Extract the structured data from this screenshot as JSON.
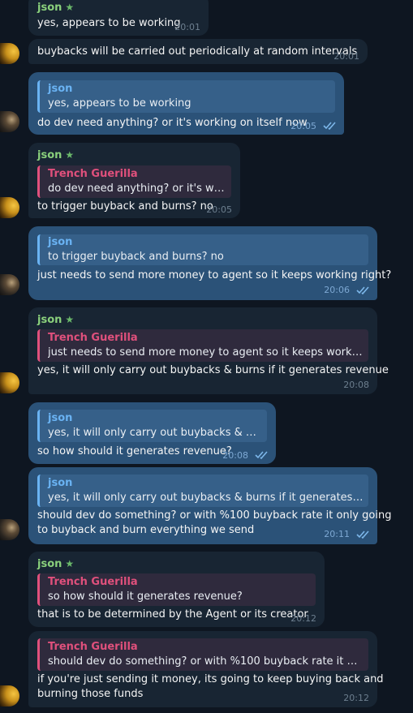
{
  "contacts": {
    "json_name": "json",
    "trench_name": "Trench Guerilla"
  },
  "messages": [
    {
      "text": "yes, appears to be working",
      "time": "20:01"
    },
    {
      "text": "buybacks will be carried out periodically at random intervals",
      "time": "20:01"
    },
    {
      "quote": "yes, appears to be working",
      "text": "do dev need anything? or it's working on itself now",
      "time": "20:05"
    },
    {
      "quote": "do dev need anything? or it's worki...",
      "text": "to trigger buyback and burns? no",
      "time": "20:05"
    },
    {
      "quote": "to trigger buyback and burns? no",
      "text": "just needs to send more money to agent so it keeps working right?",
      "time": "20:06"
    },
    {
      "quote": "just needs to send more money to agent so it keeps working rig...",
      "text": "yes, it will only carry out buybacks & burns if it generates revenue",
      "time": "20:08"
    },
    {
      "quote": "yes, it will only carry out buybacks & burns ...",
      "text": "so how should it generates revenue?",
      "time": "20:08"
    },
    {
      "quote": "yes, it will only carry out buybacks & burns if it generates revenue",
      "text_line1": "should dev do something? or with %100 buyback rate it only going",
      "text_line2": "to buyback and burn everything we send",
      "time": "20:11"
    },
    {
      "quote": "so how should it generates revenue?",
      "text": "that is to be determined by the Agent or its creator",
      "time": "20:12"
    },
    {
      "quote": "should dev do something? or with %100 buyback rate it only goi...",
      "text_line1": "if you're just sending it money, its going to keep buying back and",
      "text_line2": "burning those funds",
      "time": "20:12"
    }
  ],
  "icons": {
    "star": "star-icon",
    "read_receipt": "double-check-icon"
  },
  "colors": {
    "background": "#0e1621",
    "incoming_bubble": "#182533",
    "outgoing_bubble": "#2b5278",
    "json_name": "#8ad07c",
    "trench_name": "#e0507c",
    "reply_accent": "#6ab3f3"
  }
}
